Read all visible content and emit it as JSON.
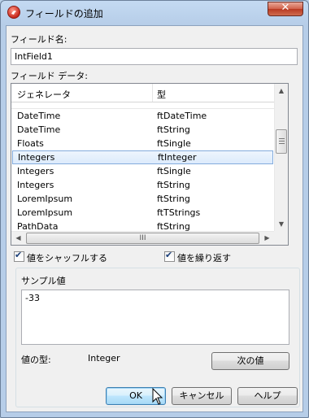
{
  "dialog": {
    "title": "フィールドの追加",
    "close_label": "✕"
  },
  "field_name": {
    "label": "フィールド名:",
    "value": "IntField1"
  },
  "field_data": {
    "label": "フィールド データ:",
    "columns": [
      "ジェネレータ",
      "型"
    ],
    "rows": [
      {
        "generator": "DateTime",
        "type": "ftDateTime"
      },
      {
        "generator": "DateTime",
        "type": "ftString"
      },
      {
        "generator": "Floats",
        "type": "ftSingle"
      },
      {
        "generator": "Integers",
        "type": "ftInteger",
        "selected": true
      },
      {
        "generator": "Integers",
        "type": "ftSingle"
      },
      {
        "generator": "Integers",
        "type": "ftString"
      },
      {
        "generator": "LoremIpsum",
        "type": "ftString"
      },
      {
        "generator": "LoremIpsum",
        "type": "ftTStrings"
      },
      {
        "generator": "PathData",
        "type": "ftString"
      }
    ],
    "hscroll_grip": "III"
  },
  "options": {
    "shuffle_label": "値をシャッフルする",
    "shuffle_checked": true,
    "repeat_label": "値を繰り返す",
    "repeat_checked": true
  },
  "sample": {
    "label": "サンプル値",
    "value": "-33",
    "type_label": "値の型:",
    "type_value": "Integer",
    "next_button": "次の値"
  },
  "footer": {
    "ok": "OK",
    "cancel": "キャンセル",
    "help": "ヘルプ"
  }
}
